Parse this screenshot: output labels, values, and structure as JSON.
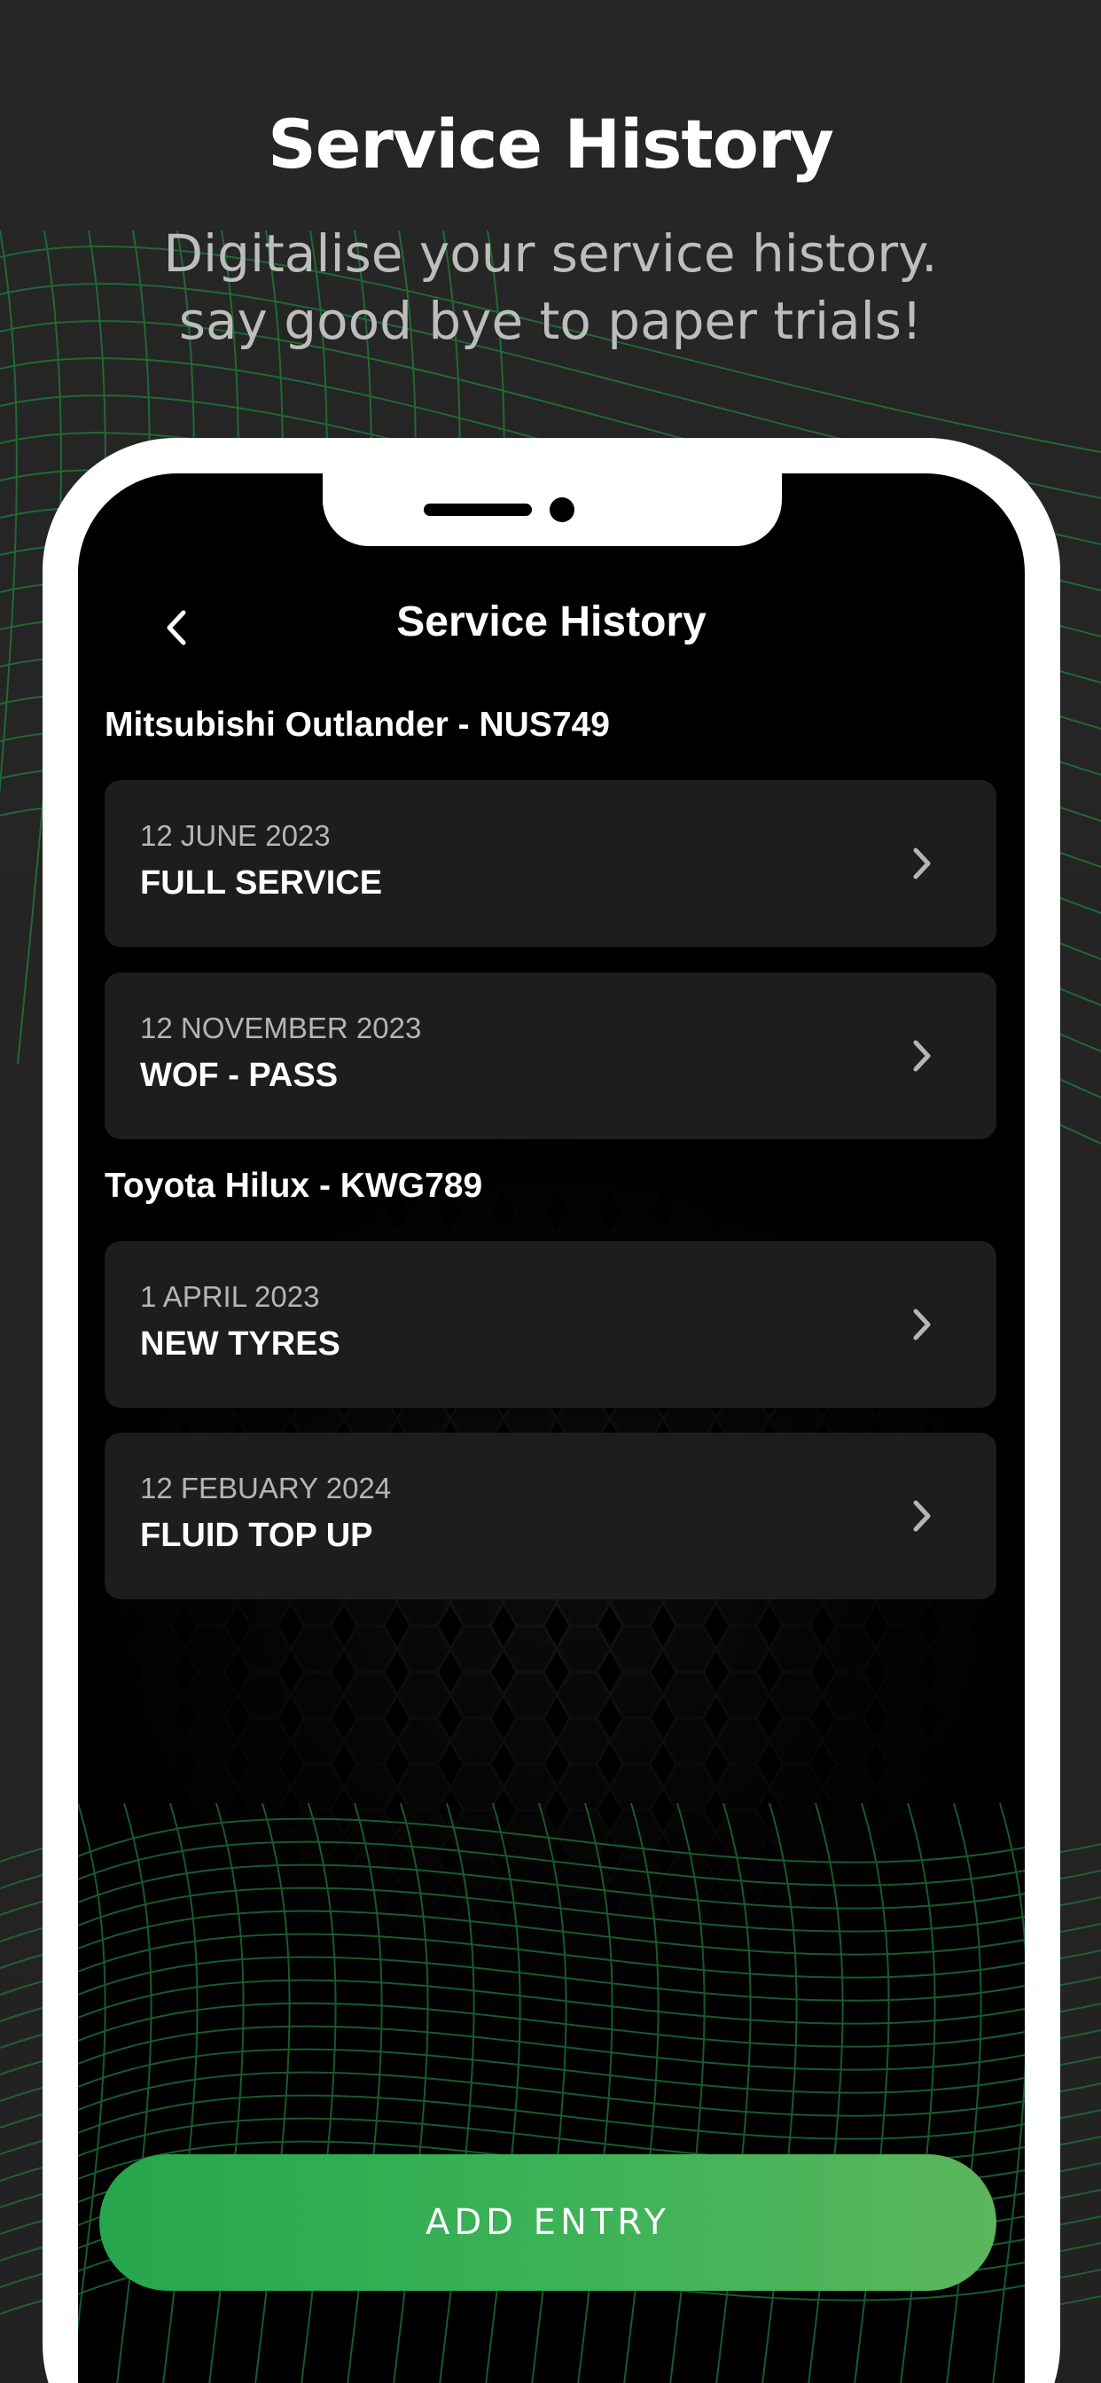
{
  "promo": {
    "headline": "Service History",
    "subhead_line1": "Digitalise your service history.",
    "subhead_line2": "say good bye to paper trials!"
  },
  "screen": {
    "title": "Service History",
    "back_icon": "chevron-left-icon"
  },
  "vehicles": [
    {
      "name": "Mitsubishi Outlander - NUS749",
      "entries": [
        {
          "date": "12 JUNE 2023",
          "type": "FULL SERVICE"
        },
        {
          "date": "12 NOVEMBER 2023",
          "type": "WOF - PASS"
        }
      ]
    },
    {
      "name": "Toyota Hilux - KWG789",
      "entries": [
        {
          "date": "1 APRIL 2023",
          "type": "NEW TYRES"
        },
        {
          "date": "12 FEBUARY 2024",
          "type": "FLUID TOP UP"
        }
      ]
    }
  ],
  "actions": {
    "add_entry_label": "ADD ENTRY"
  },
  "colors": {
    "background": "#262626",
    "accent_green_start": "#26a64d",
    "accent_green_end": "#5bb65d",
    "card_bg": "#1e1e1e",
    "mesh_green": "#1f7a3a"
  }
}
